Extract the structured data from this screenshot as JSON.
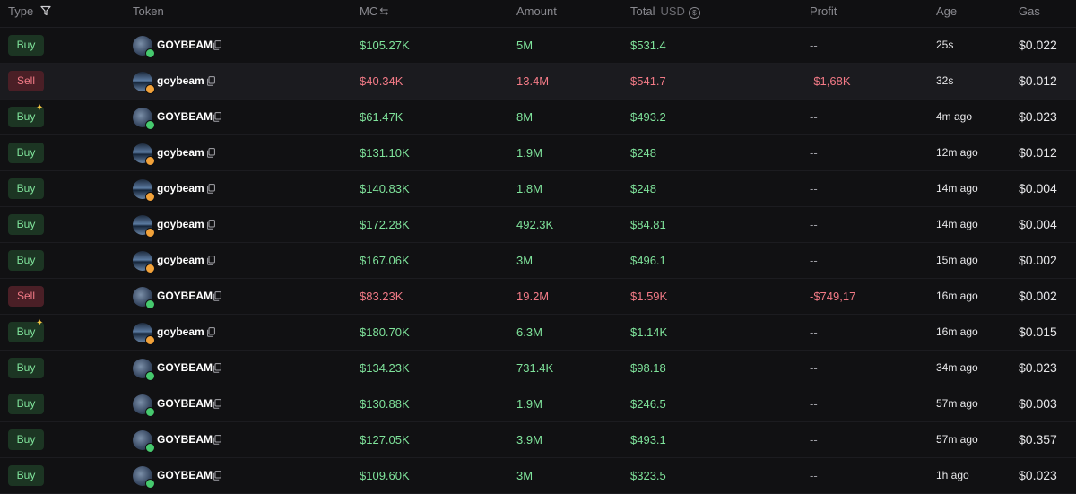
{
  "header": {
    "type": "Type",
    "token": "Token",
    "mc": "MC",
    "amount": "Amount",
    "total": "Total",
    "total_unit": "USD",
    "profit": "Profit",
    "age": "Age",
    "gas": "Gas"
  },
  "colors": {
    "buy_text": "#7fe39b",
    "buy_bg": "#1c3523",
    "sell_text": "#f27a86",
    "sell_bg": "#4a1f26",
    "background": "#101012"
  },
  "icons": {
    "filter": "funnel-icon",
    "swap": "swap-icon",
    "currency": "usd-icon",
    "copy": "copy-icon",
    "new_trader": "sparkle-icon"
  },
  "rows": [
    {
      "type": "Buy",
      "spark": false,
      "token": "GOYBEAM",
      "avatar": "a",
      "mc": "$105.27K",
      "amount": "5M",
      "total": "$531.4",
      "profit": "--",
      "age": "25s",
      "gas": "$0.022"
    },
    {
      "type": "Sell",
      "spark": false,
      "token": "goybeam",
      "avatar": "b",
      "mc": "$40.34K",
      "amount": "13.4M",
      "total": "$541.7",
      "profit": "-$1,68K",
      "age": "32s",
      "gas": "$0.012"
    },
    {
      "type": "Buy",
      "spark": true,
      "token": "GOYBEAM",
      "avatar": "a",
      "mc": "$61.47K",
      "amount": "8M",
      "total": "$493.2",
      "profit": "--",
      "age": "4m ago",
      "gas": "$0.023"
    },
    {
      "type": "Buy",
      "spark": false,
      "token": "goybeam",
      "avatar": "b",
      "mc": "$131.10K",
      "amount": "1.9M",
      "total": "$248",
      "profit": "--",
      "age": "12m ago",
      "gas": "$0.012"
    },
    {
      "type": "Buy",
      "spark": false,
      "token": "goybeam",
      "avatar": "b",
      "mc": "$140.83K",
      "amount": "1.8M",
      "total": "$248",
      "profit": "--",
      "age": "14m ago",
      "gas": "$0.004"
    },
    {
      "type": "Buy",
      "spark": false,
      "token": "goybeam",
      "avatar": "b",
      "mc": "$172.28K",
      "amount": "492.3K",
      "total": "$84.81",
      "profit": "--",
      "age": "14m ago",
      "gas": "$0.004"
    },
    {
      "type": "Buy",
      "spark": false,
      "token": "goybeam",
      "avatar": "b",
      "mc": "$167.06K",
      "amount": "3M",
      "total": "$496.1",
      "profit": "--",
      "age": "15m ago",
      "gas": "$0.002"
    },
    {
      "type": "Sell",
      "spark": false,
      "token": "GOYBEAM",
      "avatar": "a",
      "mc": "$83.23K",
      "amount": "19.2M",
      "total": "$1.59K",
      "profit": "-$749,17",
      "age": "16m ago",
      "gas": "$0.002"
    },
    {
      "type": "Buy",
      "spark": true,
      "token": "goybeam",
      "avatar": "b",
      "mc": "$180.70K",
      "amount": "6.3M",
      "total": "$1.14K",
      "profit": "--",
      "age": "16m ago",
      "gas": "$0.015"
    },
    {
      "type": "Buy",
      "spark": false,
      "token": "GOYBEAM",
      "avatar": "a",
      "mc": "$134.23K",
      "amount": "731.4K",
      "total": "$98.18",
      "profit": "--",
      "age": "34m ago",
      "gas": "$0.023"
    },
    {
      "type": "Buy",
      "spark": false,
      "token": "GOYBEAM",
      "avatar": "a",
      "mc": "$130.88K",
      "amount": "1.9M",
      "total": "$246.5",
      "profit": "--",
      "age": "57m ago",
      "gas": "$0.003"
    },
    {
      "type": "Buy",
      "spark": false,
      "token": "GOYBEAM",
      "avatar": "a",
      "mc": "$127.05K",
      "amount": "3.9M",
      "total": "$493.1",
      "profit": "--",
      "age": "57m ago",
      "gas": "$0.357"
    },
    {
      "type": "Buy",
      "spark": false,
      "token": "GOYBEAM",
      "avatar": "a",
      "mc": "$109.60K",
      "amount": "3M",
      "total": "$323.5",
      "profit": "--",
      "age": "1h ago",
      "gas": "$0.023"
    }
  ]
}
